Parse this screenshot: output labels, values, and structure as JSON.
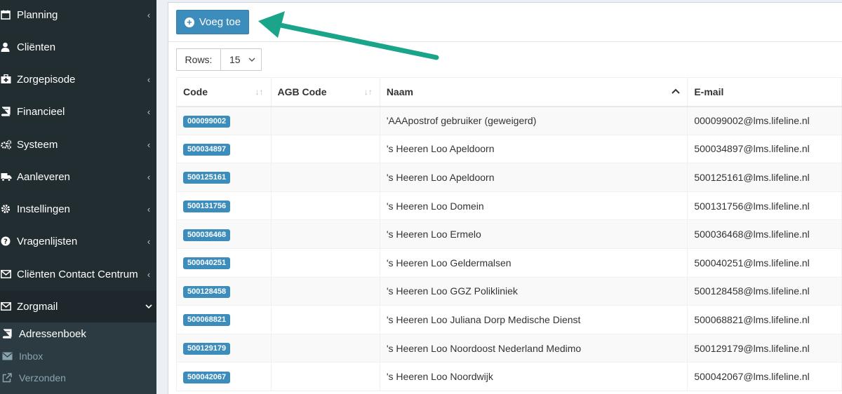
{
  "sidebar": {
    "items": [
      {
        "label": "Planning",
        "icon": "calendar-icon",
        "chevron": true
      },
      {
        "label": "Cliënten",
        "icon": "user-icon",
        "chevron": false
      },
      {
        "label": "Zorgepisode",
        "icon": "medkit-icon",
        "chevron": true
      },
      {
        "label": "Financieel",
        "icon": "book-icon",
        "chevron": true
      },
      {
        "label": "Systeem",
        "icon": "gears-icon",
        "chevron": true
      },
      {
        "label": "Aanleveren",
        "icon": "truck-icon",
        "chevron": true
      },
      {
        "label": "Instellingen",
        "icon": "gear-icon",
        "chevron": true
      },
      {
        "label": "Vragenlijsten",
        "icon": "question-circle-icon",
        "chevron": true
      },
      {
        "label": "Cliënten Contact Centrum",
        "icon": "envelope-icon",
        "chevron": true
      },
      {
        "label": "Zorgmail",
        "icon": "envelope-icon",
        "chevron": true
      }
    ],
    "subitems": [
      {
        "label": "Adressenboek",
        "icon": "book-icon"
      },
      {
        "label": "Inbox",
        "icon": "envelope-icon"
      },
      {
        "label": "Verzonden",
        "icon": "external-link-icon"
      }
    ]
  },
  "toolbar": {
    "add_label": "Voeg toe"
  },
  "rows": {
    "label": "Rows:",
    "value": "15"
  },
  "table": {
    "headers": [
      "Code",
      "AGB Code",
      "Naam",
      "E-mail"
    ],
    "rows": [
      {
        "code": "000099002",
        "agb": "",
        "naam": "'AAApostrof gebruiker (geweigerd)",
        "email": "000099002@lms.lifeline.nl"
      },
      {
        "code": "500034897",
        "agb": "",
        "naam": "'s Heeren Loo Apeldoorn",
        "email": "500034897@lms.lifeline.nl"
      },
      {
        "code": "500125161",
        "agb": "",
        "naam": "'s Heeren Loo Apeldoorn",
        "email": "500125161@lms.lifeline.nl"
      },
      {
        "code": "500131756",
        "agb": "",
        "naam": "'s Heeren Loo Domein",
        "email": "500131756@lms.lifeline.nl"
      },
      {
        "code": "500036468",
        "agb": "",
        "naam": "'s Heeren Loo Ermelo",
        "email": "500036468@lms.lifeline.nl"
      },
      {
        "code": "500040251",
        "agb": "",
        "naam": "'s Heeren Loo Geldermalsen",
        "email": "500040251@lms.lifeline.nl"
      },
      {
        "code": "500128458",
        "agb": "",
        "naam": "'s Heeren Loo GGZ Polikliniek",
        "email": "500128458@lms.lifeline.nl"
      },
      {
        "code": "500068821",
        "agb": "",
        "naam": "'s Heeren Loo Juliana Dorp Medische Dienst",
        "email": "500068821@lms.lifeline.nl"
      },
      {
        "code": "500129179",
        "agb": "",
        "naam": "'s Heeren Loo Noordoost Nederland Medimo",
        "email": "500129179@lms.lifeline.nl"
      },
      {
        "code": "500042067",
        "agb": "",
        "naam": "'s Heeren Loo Noordwijk",
        "email": "500042067@lms.lifeline.nl"
      }
    ]
  },
  "colors": {
    "primary": "#3c8dbc",
    "sidebar": "#222d32",
    "annotation_arrow": "#1aa58a"
  }
}
